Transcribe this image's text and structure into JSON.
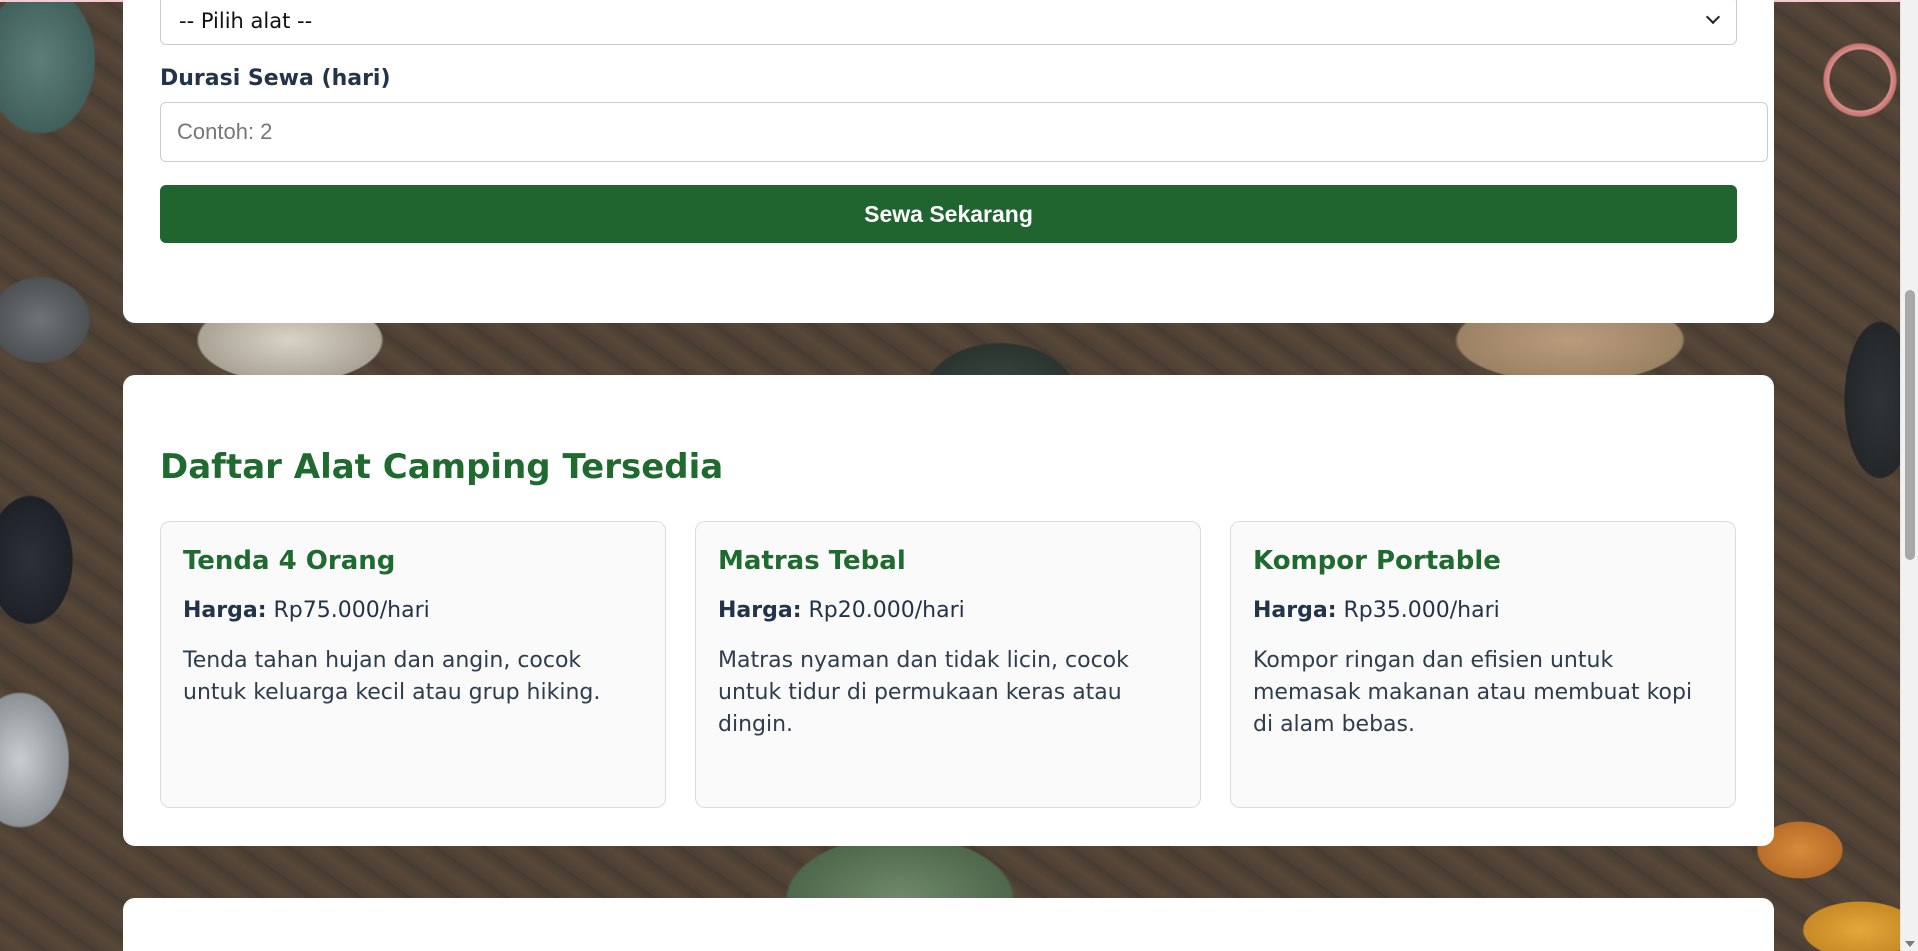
{
  "form": {
    "select_value": "-- Pilih alat --",
    "duration_label": "Durasi Sewa (hari)",
    "duration_placeholder": "Contoh: 2",
    "submit_label": "Sewa Sekarang"
  },
  "list": {
    "title": "Daftar Alat Camping Tersedia",
    "price_label": "Harga:",
    "items": [
      {
        "name": "Tenda 4 Orang",
        "price": "Rp75.000/hari",
        "description": "Tenda tahan hujan dan angin, cocok untuk keluarga kecil atau grup hiking."
      },
      {
        "name": "Matras Tebal",
        "price": "Rp20.000/hari",
        "description": "Matras nyaman dan tidak licin, cocok untuk tidur di permukaan keras atau dingin."
      },
      {
        "name": "Kompor Portable",
        "price": "Rp35.000/hari",
        "description": "Kompor ringan dan efisien untuk memasak makanan atau membuat kopi di alam bebas."
      }
    ]
  },
  "colors": {
    "accent_green": "#206530",
    "heading_green": "#1f6a2f",
    "card_background": "#ffffff"
  }
}
